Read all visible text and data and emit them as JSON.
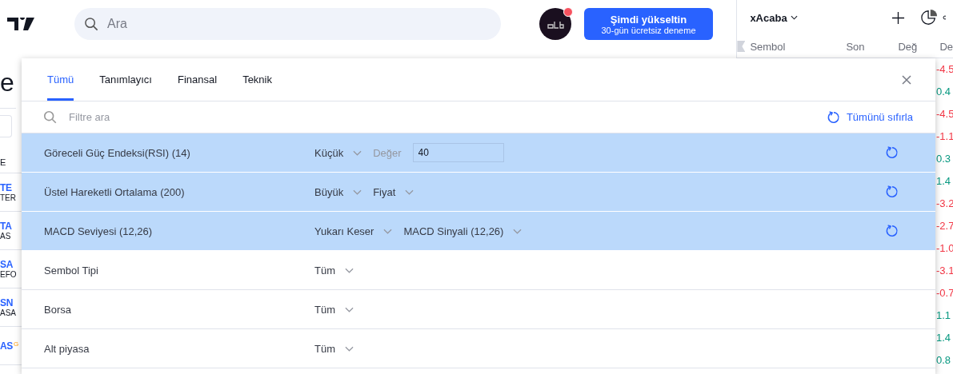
{
  "header": {
    "search": {
      "placeholder": "Ara"
    },
    "upgrade_button": {
      "title": "Şimdi yükseltin",
      "subtitle": "30-gün ücretsiz deneme"
    },
    "notification_dot": true
  },
  "watchlist": {
    "title": "xAcaba",
    "columns": [
      "Sembol",
      "Son",
      "Değ",
      "De"
    ],
    "values": [
      {
        "text": "-4.5",
        "color": "#f23645"
      },
      {
        "text": "0.4",
        "color": "#089981"
      },
      {
        "text": "-4.5",
        "color": "#f23645"
      },
      {
        "text": "-1.1",
        "color": "#f23645"
      },
      {
        "text": "0.3",
        "color": "#089981"
      },
      {
        "text": "1.4",
        "color": "#089981"
      },
      {
        "text": "-3.2",
        "color": "#f23645"
      },
      {
        "text": "-2.7",
        "color": "#f23645"
      },
      {
        "text": "-1.0",
        "color": "#f23645"
      },
      {
        "text": "-3.1",
        "color": "#f23645"
      },
      {
        "text": "-0.7",
        "color": "#f23645"
      },
      {
        "text": "1.1",
        "color": "#089981"
      },
      {
        "text": "1.4",
        "color": "#089981"
      },
      {
        "text": "0.8",
        "color": "#089981"
      }
    ]
  },
  "background": {
    "heading": "e",
    "column_label": "E",
    "rows": [
      {
        "symbol": "TE",
        "name": "TER"
      },
      {
        "symbol": "TA",
        "name": "AS"
      },
      {
        "symbol": "SA",
        "name": "EFO"
      },
      {
        "symbol": "SN",
        "name": "ASA"
      },
      {
        "symbol": "AS",
        "badge": "G"
      }
    ]
  },
  "dialog": {
    "tabs": [
      {
        "label": "Tümü",
        "selected": true
      },
      {
        "label": "Tanımlayıcı",
        "selected": false
      },
      {
        "label": "Finansal",
        "selected": false
      },
      {
        "label": "Teknik",
        "selected": false
      }
    ],
    "filter": {
      "placeholder": "Filtre ara"
    },
    "reset_all": "Tümünü sıfırla",
    "rows": [
      {
        "name": "Göreceli Güç Endeksi(RSI) (14)",
        "selected": true,
        "controls": [
          {
            "kind": "dropdown",
            "text": "Küçük"
          },
          {
            "kind": "label",
            "text": "Değer"
          },
          {
            "kind": "input",
            "text": "40"
          }
        ]
      },
      {
        "name": "Üstel Hareketli Ortalama (200)",
        "selected": true,
        "controls": [
          {
            "kind": "dropdown",
            "text": "Büyük"
          },
          {
            "kind": "dropdown",
            "text": "Fiyat"
          }
        ]
      },
      {
        "name": "MACD Seviyesi (12,26)",
        "selected": true,
        "controls": [
          {
            "kind": "dropdown",
            "text": "Yukarı Keser"
          },
          {
            "kind": "dropdown",
            "text": "MACD Sinyali (12,26)"
          }
        ]
      },
      {
        "name": "Sembol Tipi",
        "selected": false,
        "controls": [
          {
            "kind": "dropdown",
            "text": "Tüm"
          }
        ]
      },
      {
        "name": "Borsa",
        "selected": false,
        "controls": [
          {
            "kind": "dropdown",
            "text": "Tüm"
          }
        ]
      },
      {
        "name": "Alt piyasa",
        "selected": false,
        "controls": [
          {
            "kind": "dropdown",
            "text": "Tüm"
          }
        ]
      }
    ]
  }
}
